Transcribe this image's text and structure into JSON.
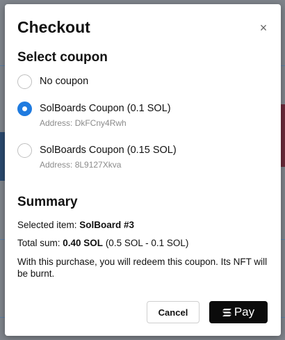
{
  "modal": {
    "title": "Checkout",
    "close_glyph": "×"
  },
  "coupon_section": {
    "title": "Select coupon",
    "options": [
      {
        "label": "No coupon",
        "address": "",
        "selected": false
      },
      {
        "label": "SolBoards Coupon (0.1 SOL)",
        "address": "Address: DkFCny4Rwh",
        "selected": true
      },
      {
        "label": "SolBoards Coupon (0.15 SOL)",
        "address": "Address: 8L9127Xkva",
        "selected": false
      }
    ]
  },
  "summary": {
    "title": "Summary",
    "selected_item_prefix": "Selected item: ",
    "selected_item_value": "SolBoard #3",
    "total_prefix": "Total sum: ",
    "total_value": "0.40 SOL",
    "total_breakdown": " (0.5 SOL - 0.1 SOL)",
    "notice": "With this purchase, you will redeem this coupon. Its NFT will be burnt."
  },
  "actions": {
    "cancel_label": "Cancel",
    "pay_label": "Pay",
    "pay_icon": "solana-icon"
  },
  "colors": {
    "accent": "#1f7be0",
    "pay_button": "#0b0b0b",
    "backdrop": "#7f848b"
  }
}
